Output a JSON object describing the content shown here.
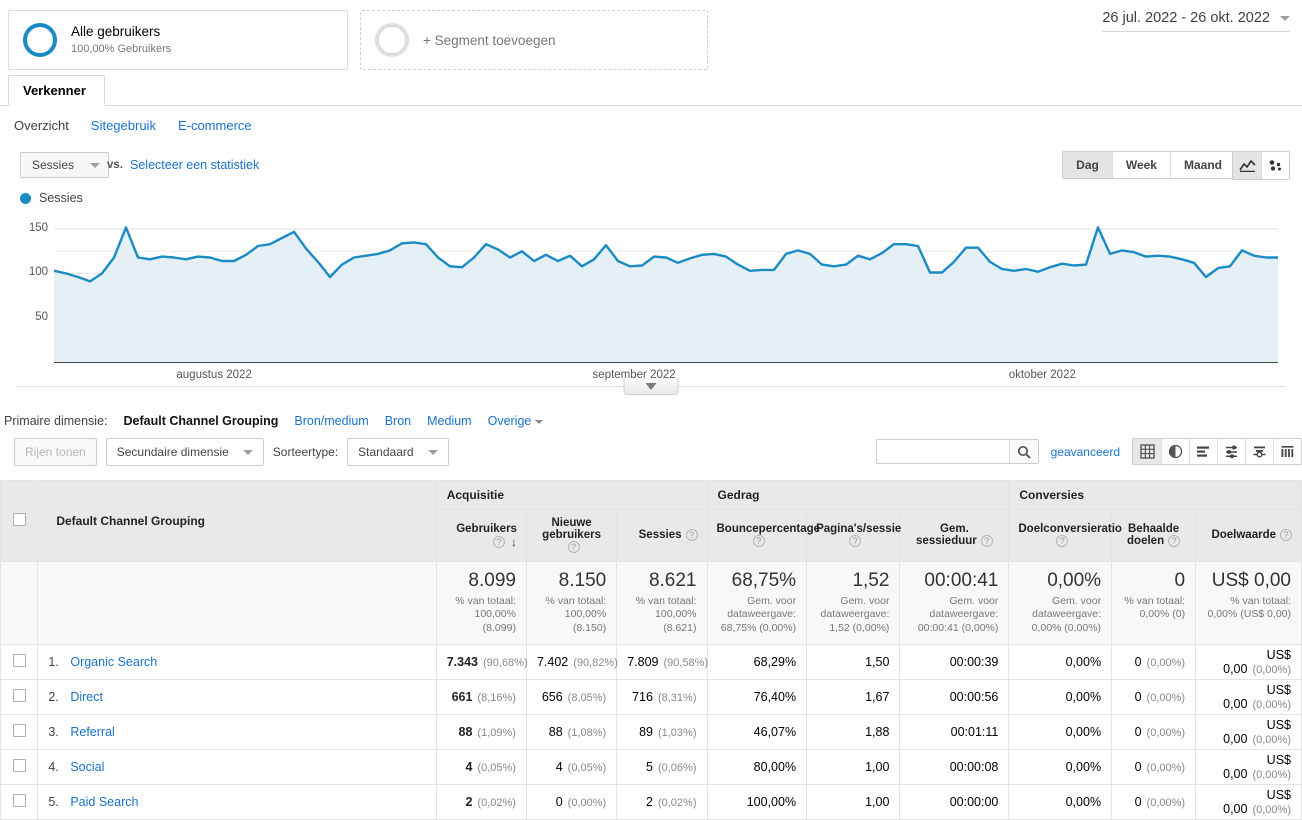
{
  "segments": {
    "all_users": {
      "title": "Alle gebruikers",
      "subtitle": "100,00% Gebruikers"
    },
    "add": {
      "label": "+ Segment toevoegen"
    }
  },
  "date_range": {
    "value": "26 jul. 2022 - 26 okt. 2022"
  },
  "tabs": {
    "explorer": "Verkenner"
  },
  "subnav": [
    {
      "label": "Overzicht",
      "active": true
    },
    {
      "label": "Sitegebruik",
      "active": false
    },
    {
      "label": "E-commerce",
      "active": false
    }
  ],
  "chart_controls": {
    "metric": "Sessies",
    "vs": "vs.",
    "select_metric": "Selecteer een statistiek",
    "granularity": [
      {
        "label": "Dag",
        "selected": true
      },
      {
        "label": "Week",
        "selected": false
      },
      {
        "label": "Maand",
        "selected": false
      }
    ],
    "view_icons": [
      {
        "name": "line-chart-icon",
        "selected": true
      },
      {
        "name": "motion-chart-icon",
        "selected": false
      }
    ]
  },
  "chart_data": {
    "type": "line",
    "title": "Sessies",
    "legend": [
      "Sessies"
    ],
    "legend_position": "top-left",
    "xlabel": "",
    "ylabel": "",
    "ylim": [
      0,
      175
    ],
    "yticks": [
      50,
      100,
      150
    ],
    "grid": true,
    "line_color": "#1a8bc4",
    "fill_color": "#e4eff6",
    "x_tick_labels": [
      "augustus 2022",
      "september 2022",
      "oktober 2022"
    ],
    "x_tick_positions": [
      0.1,
      0.44,
      0.78
    ],
    "series": [
      {
        "name": "Sessies",
        "values": [
          103,
          100,
          96,
          91,
          100,
          118,
          152,
          118,
          116,
          119,
          118,
          116,
          119,
          118,
          114,
          114,
          121,
          131,
          133,
          140,
          147,
          128,
          113,
          96,
          110,
          118,
          120,
          122,
          126,
          134,
          135,
          133,
          118,
          108,
          107,
          118,
          133,
          127,
          118,
          125,
          114,
          121,
          114,
          120,
          108,
          116,
          132,
          114,
          108,
          109,
          119,
          118,
          112,
          117,
          121,
          122,
          119,
          110,
          103,
          104,
          104,
          122,
          126,
          122,
          110,
          108,
          110,
          120,
          116,
          123,
          133,
          133,
          131,
          101,
          101,
          113,
          129,
          129,
          113,
          105,
          103,
          105,
          102,
          107,
          111,
          109,
          110,
          152,
          122,
          126,
          124,
          119,
          120,
          119,
          116,
          112,
          96,
          106,
          108,
          126,
          120,
          118,
          118
        ]
      }
    ]
  },
  "primary_dimension": {
    "label": "Primaire dimensie:",
    "current": "Default Channel Grouping",
    "options": [
      "Bron/medium",
      "Bron",
      "Medium"
    ],
    "other": "Overige"
  },
  "table_controls": {
    "show_rows": "Rijen tonen",
    "secondary_dimension": "Secundaire dimensie",
    "sort_type_label": "Sorteertype:",
    "sort_type_value": "Standaard",
    "search_value": "",
    "search_placeholder": "",
    "advanced": "geavanceerd",
    "view_icons": [
      {
        "name": "table-view-icon",
        "selected": true
      },
      {
        "name": "pie-chart-view-icon",
        "selected": false
      },
      {
        "name": "performance-view-icon",
        "selected": false
      },
      {
        "name": "comparison-view-icon",
        "selected": false
      },
      {
        "name": "term-cloud-view-icon",
        "selected": false
      },
      {
        "name": "pivot-view-icon",
        "selected": false
      }
    ]
  },
  "table": {
    "group_headers": [
      {
        "label": "Acquisitie",
        "span": 3
      },
      {
        "label": "Gedrag",
        "span": 3
      },
      {
        "label": "Conversies",
        "span": 3
      }
    ],
    "dimension_header": "Default Channel Grouping",
    "columns": [
      {
        "label": "Gebruikers",
        "sorted": "desc"
      },
      {
        "label": "Nieuwe gebruikers",
        "sorted": ""
      },
      {
        "label": "Sessies",
        "sorted": ""
      },
      {
        "label": "Bouncepercentage",
        "sorted": ""
      },
      {
        "label": "Pagina's/sessie",
        "sorted": ""
      },
      {
        "label": "Gem. sessieduur",
        "sorted": ""
      },
      {
        "label": "Doelconversieratio",
        "sorted": ""
      },
      {
        "label": "Behaalde doelen",
        "sorted": ""
      },
      {
        "label": "Doelwaarde",
        "sorted": ""
      }
    ],
    "totals": [
      {
        "value": "8.099",
        "sub": "% van totaal: 100,00% (8.099)"
      },
      {
        "value": "8.150",
        "sub": "% van totaal: 100,00% (8.150)"
      },
      {
        "value": "8.621",
        "sub": "% van totaal: 100,00% (8.621)"
      },
      {
        "value": "68,75%",
        "sub": "Gem. voor dataweergave: 68,75% (0,00%)"
      },
      {
        "value": "1,52",
        "sub": "Gem. voor dataweergave: 1,52 (0,00%)"
      },
      {
        "value": "00:00:41",
        "sub": "Gem. voor dataweergave: 00:00:41 (0,00%)"
      },
      {
        "value": "0,00%",
        "sub": "Gem. voor dataweergave: 0,00% (0,00%)"
      },
      {
        "value": "0",
        "sub": "% van totaal: 0,00% (0)"
      },
      {
        "value": "US$ 0,00",
        "sub": "% van totaal: 0,00% (US$ 0,00)"
      }
    ],
    "rows": [
      {
        "index": "1.",
        "name": "Organic Search",
        "users": "7.343",
        "users_pct": "(90,68%)",
        "new_users": "7.402",
        "new_users_pct": "(90,82%)",
        "sessions": "7.809",
        "sessions_pct": "(90,58%)",
        "bounce": "68,29%",
        "pages": "1,50",
        "duration": "00:00:39",
        "goal_rate": "0,00%",
        "goals": "0",
        "goals_pct": "(0,00%)",
        "goal_value": "US$ 0,00",
        "goal_value_pct": "(0,00%)"
      },
      {
        "index": "2.",
        "name": "Direct",
        "users": "661",
        "users_pct": "(8,16%)",
        "new_users": "656",
        "new_users_pct": "(8,05%)",
        "sessions": "716",
        "sessions_pct": "(8,31%)",
        "bounce": "76,40%",
        "pages": "1,67",
        "duration": "00:00:56",
        "goal_rate": "0,00%",
        "goals": "0",
        "goals_pct": "(0,00%)",
        "goal_value": "US$ 0,00",
        "goal_value_pct": "(0,00%)"
      },
      {
        "index": "3.",
        "name": "Referral",
        "users": "88",
        "users_pct": "(1,09%)",
        "new_users": "88",
        "new_users_pct": "(1,08%)",
        "sessions": "89",
        "sessions_pct": "(1,03%)",
        "bounce": "46,07%",
        "pages": "1,88",
        "duration": "00:01:11",
        "goal_rate": "0,00%",
        "goals": "0",
        "goals_pct": "(0,00%)",
        "goal_value": "US$ 0,00",
        "goal_value_pct": "(0,00%)"
      },
      {
        "index": "4.",
        "name": "Social",
        "users": "4",
        "users_pct": "(0,05%)",
        "new_users": "4",
        "new_users_pct": "(0,05%)",
        "sessions": "5",
        "sessions_pct": "(0,06%)",
        "bounce": "80,00%",
        "pages": "1,00",
        "duration": "00:00:08",
        "goal_rate": "0,00%",
        "goals": "0",
        "goals_pct": "(0,00%)",
        "goal_value": "US$ 0,00",
        "goal_value_pct": "(0,00%)"
      },
      {
        "index": "5.",
        "name": "Paid Search",
        "users": "2",
        "users_pct": "(0,02%)",
        "new_users": "0",
        "new_users_pct": "(0,00%)",
        "sessions": "2",
        "sessions_pct": "(0,02%)",
        "bounce": "100,00%",
        "pages": "1,00",
        "duration": "00:00:00",
        "goal_rate": "0,00%",
        "goals": "0",
        "goals_pct": "(0,00%)",
        "goal_value": "US$ 0,00",
        "goal_value_pct": "(0,00%)"
      }
    ]
  },
  "colors": {
    "accent": "#1a8bc4",
    "link": "#1a73c9",
    "chart_fill": "#e4eff6"
  }
}
